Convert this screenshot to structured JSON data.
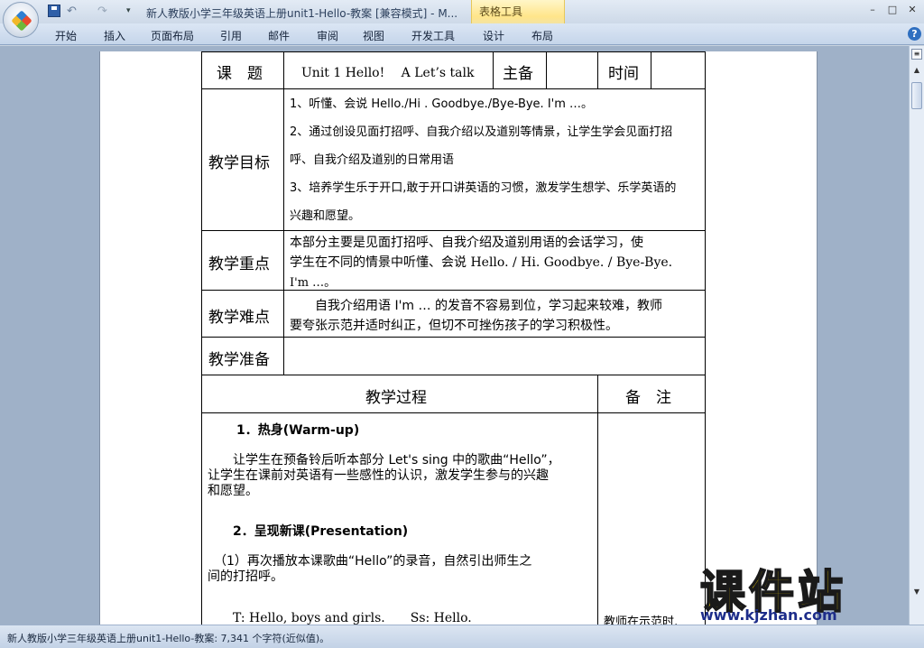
{
  "titlebar": {
    "doc_title": "新人教版小学三年级英语上册unit1-Hello-教案 [兼容模式] - M...",
    "context_tab": "表格工具",
    "undo_glyph": "↶",
    "redo_glyph": "↷",
    "more_glyph": "▾",
    "min_glyph": "–",
    "max_glyph": "□",
    "close_glyph": "✕"
  },
  "ribbon": {
    "tabs": [
      "开始",
      "插入",
      "页面布局",
      "引用",
      "邮件",
      "审阅",
      "视图",
      "开发工具",
      "设计",
      "布局"
    ],
    "help_glyph": "?"
  },
  "table": {
    "row1": {
      "label": "课　题",
      "topic": "Unit 1 Hello!　 A Let’s talk",
      "zhubei": "主备",
      "time": "时间"
    },
    "objectives": {
      "label": "教学目标",
      "items": [
        "1、听懂、会说 Hello./Hi . Goodbye./Bye-Bye. I'm …。",
        "2、通过创设见面打招呼、自我介绍以及道别等情景，让学生学会见面打招",
        "呼、自我介绍及道别的日常用语",
        "3、培养学生乐于开口,敢于开口讲英语的习惯，激发学生想学、乐学英语的",
        "兴趣和愿望。"
      ]
    },
    "key_points": {
      "label": "教学重点",
      "lines": [
        "本部分主要是见面打招呼、自我介绍及道别用语的会话学习，使",
        "学生在不同的情景中听懂、会说  Hello. / Hi. Goodbye. / Bye-Bye.",
        "I'm …。"
      ]
    },
    "difficulties": {
      "label": "教学难点",
      "lines": [
        "　　自我介绍用语 I'm … 的发音不容易到位，学习起来较难，教师",
        "要夸张示范并适时纠正，但切不可挫伤孩子的学习积极性。"
      ]
    },
    "preparation": {
      "label": "教学准备"
    },
    "process_header": "教学过程",
    "notes_header": "备　注",
    "process": {
      "step1_title": "1．热身(Warm-up)",
      "step1_lines": [
        "　　让学生在预备铃后听本部分 Let's sing 中的歌曲“Hello”，",
        "让学生在课前对英语有一些感性的认识，激发学生参与的兴趣",
        "和愿望。"
      ],
      "step2_title": "2．呈现新课(Presentation)",
      "step2_lines": [
        "　（1）再次播放本课歌曲“Hello”的录音，自然引出师生之",
        "间的打招呼。"
      ],
      "dialog": "T: Hello, boys and girls.　　Ss: Hello."
    },
    "notes_text": "教师在示范时,"
  },
  "status": {
    "text": "新人教版小学三年级英语上册unit1-Hello-教案: 7,341 个字符(近似值)。"
  },
  "watermark": {
    "big": "课件站",
    "url": "www.kjzhan.com"
  }
}
